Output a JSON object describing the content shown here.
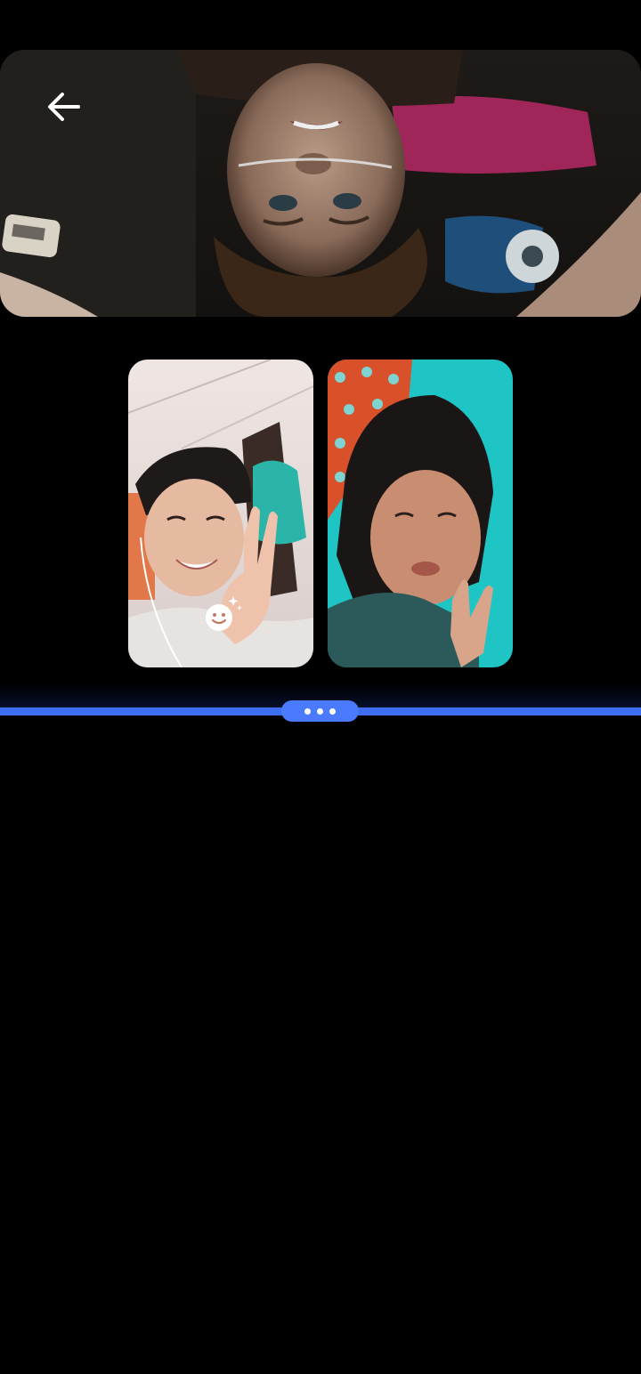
{
  "screen": {
    "background_color": "#000000"
  },
  "shared_video": {
    "content": "movie-scene",
    "back_icon": "arrow-left-icon"
  },
  "participants": [
    {
      "id": "participant-1",
      "effects_icon": "face-effects-icon"
    },
    {
      "id": "participant-2"
    }
  ],
  "divider": {
    "line_color": "#3d6ef0",
    "handle_color": "#4a7bff",
    "handle_icon": "more-dots-icon"
  }
}
